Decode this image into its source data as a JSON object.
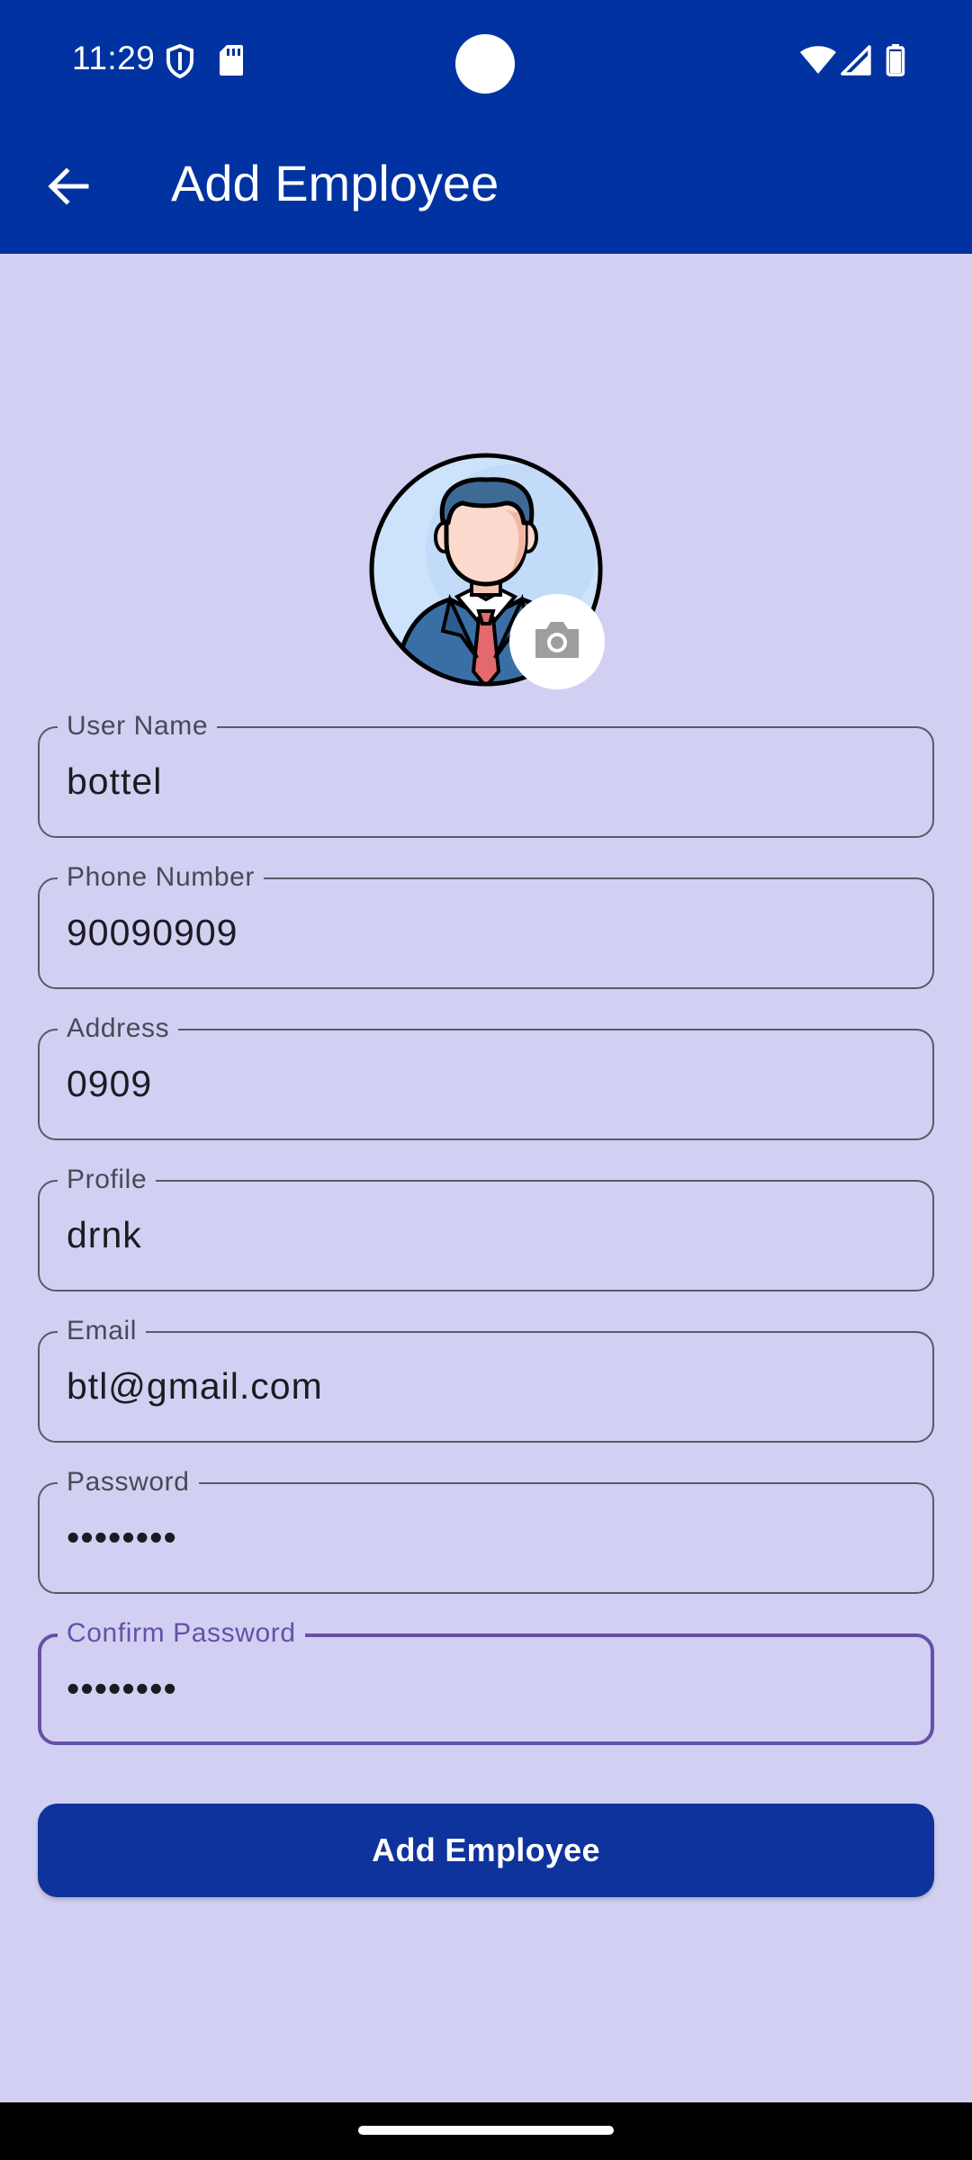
{
  "status_bar": {
    "time": "11:29",
    "left_icons": [
      "shield-icon",
      "sd-card-icon"
    ],
    "right_icons": [
      "wifi-icon",
      "cellular-signal-icon",
      "battery-icon"
    ]
  },
  "app_bar": {
    "back_icon": "arrow-left-icon",
    "title": "Add Employee"
  },
  "avatar": {
    "image": "businessman-avatar",
    "camera_icon": "camera-icon"
  },
  "form": {
    "fields": [
      {
        "label": "User Name",
        "value": "bottel"
      },
      {
        "label": "Phone Number",
        "value": "90090909"
      },
      {
        "label": "Address",
        "value": "0909"
      },
      {
        "label": "Profile",
        "value": "drnk"
      },
      {
        "label": "Email",
        "value": "btl@gmail.com"
      },
      {
        "label": "Password",
        "value": "••••••••"
      },
      {
        "label": "Confirm Password",
        "value": "••••••••"
      }
    ],
    "submit_label": "Add Employee"
  },
  "colors": {
    "app_bar": "#0033a1",
    "background": "#d2d0f2",
    "button": "#0f339c",
    "focus_outline": "#6650a8"
  }
}
